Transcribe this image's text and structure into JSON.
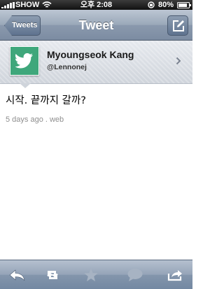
{
  "status_bar": {
    "carrier": "SHOW",
    "time": "오후 2:08",
    "battery": "80%"
  },
  "nav": {
    "back_label": "Tweets",
    "title": "Tweet",
    "compose_icon": "compose-icon"
  },
  "user": {
    "name": "Myoungseok Kang",
    "handle": "@Lennonej",
    "avatar_icon": "twitter-bird-icon",
    "avatar_color": "#3fa77b"
  },
  "tweet": {
    "text": "시작. 끝까지 갈까?",
    "meta": "5 days ago . web"
  },
  "toolbar": {
    "items": [
      "reply-icon",
      "retweet-icon",
      "favorite-star-icon",
      "speech-bubble-icon",
      "share-icon"
    ]
  }
}
